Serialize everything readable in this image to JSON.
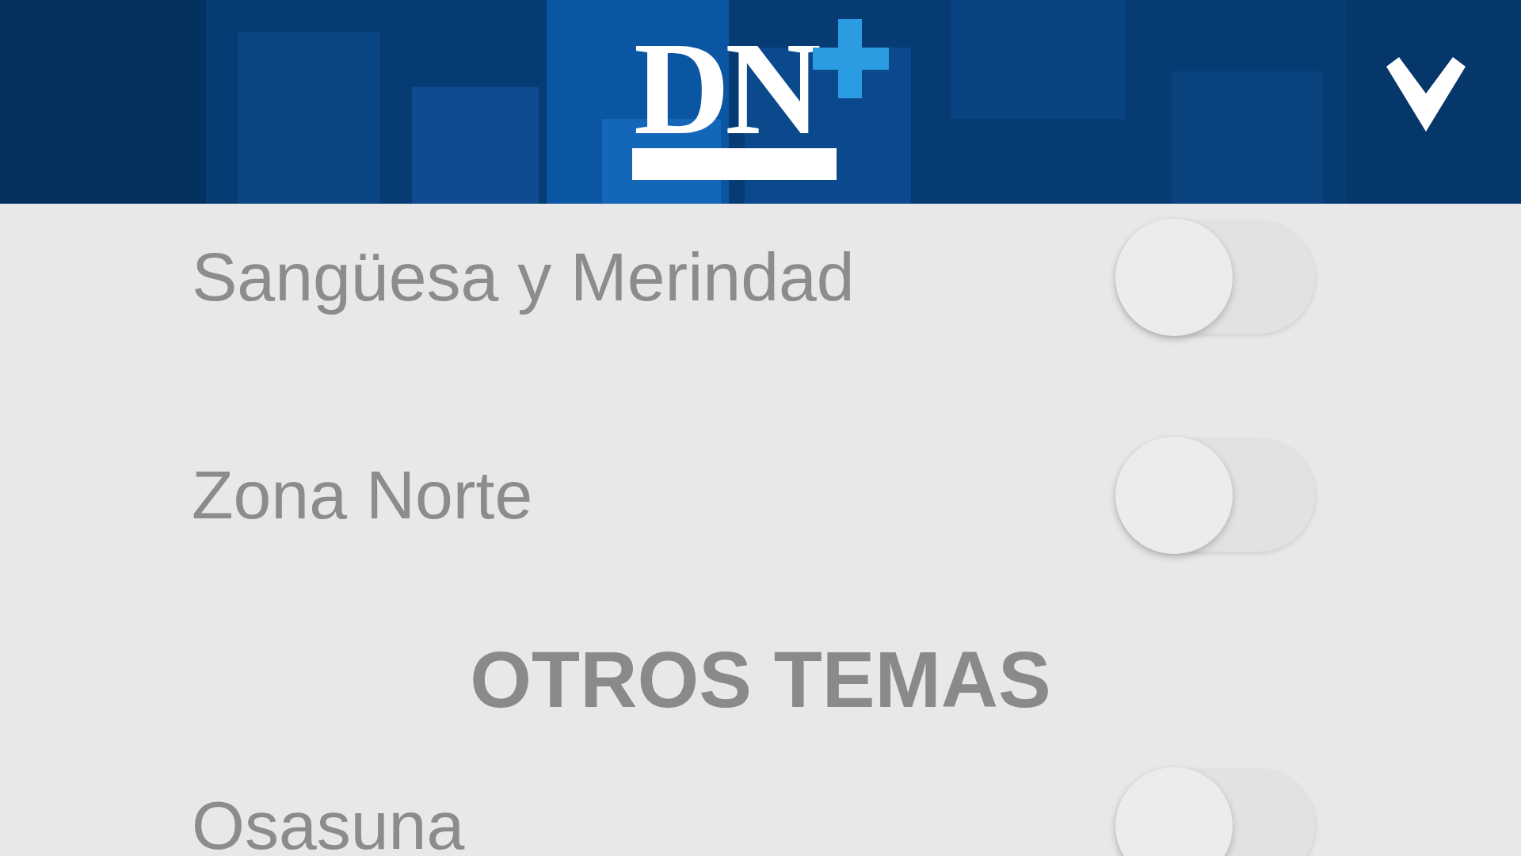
{
  "header": {
    "logo": "DN"
  },
  "items": [
    {
      "kind": "toggle",
      "label": "Sangüesa y Merindad",
      "on": false
    },
    {
      "kind": "toggle",
      "label": "Zona Norte",
      "on": false
    },
    {
      "kind": "heading",
      "label": "OTROS TEMAS"
    },
    {
      "kind": "toggle",
      "label": "Osasuna",
      "on": false
    }
  ]
}
